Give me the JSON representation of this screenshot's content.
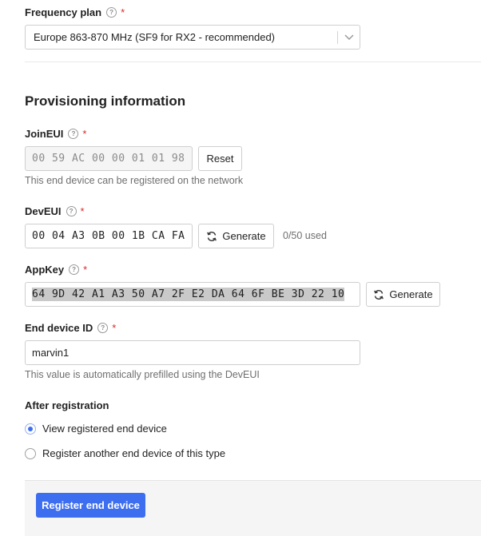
{
  "frequency_plan": {
    "label": "Frequency plan",
    "value": "Europe 863-870 MHz (SF9 for RX2 - recommended)"
  },
  "provisioning": {
    "heading": "Provisioning information"
  },
  "join_eui": {
    "label": "JoinEUI",
    "value": "00 59 AC 00 00 01 01 98",
    "reset_label": "Reset",
    "hint": "This end device can be registered on the network"
  },
  "dev_eui": {
    "label": "DevEUI",
    "value": "00 04 A3 0B 00 1B CA FA",
    "generate_label": "Generate",
    "usage": "0/50 used"
  },
  "app_key": {
    "label": "AppKey",
    "value": "64 9D 42 A1 A3 50 A7 2F E2 DA 64 6F BE 3D 22 10",
    "generate_label": "Generate"
  },
  "end_device_id": {
    "label": "End device ID",
    "value": "marvin1",
    "hint": "This value is automatically prefilled using the DevEUI"
  },
  "after_registration": {
    "label": "After registration",
    "options": [
      {
        "label": "View registered end device",
        "selected": true
      },
      {
        "label": "Register another end device of this type",
        "selected": false
      }
    ]
  },
  "footer": {
    "register_label": "Register end device"
  },
  "common": {
    "help_glyph": "?",
    "required_mark": "*"
  },
  "colors": {
    "primary": "#3d6ef0",
    "required": "#d92b2b"
  }
}
